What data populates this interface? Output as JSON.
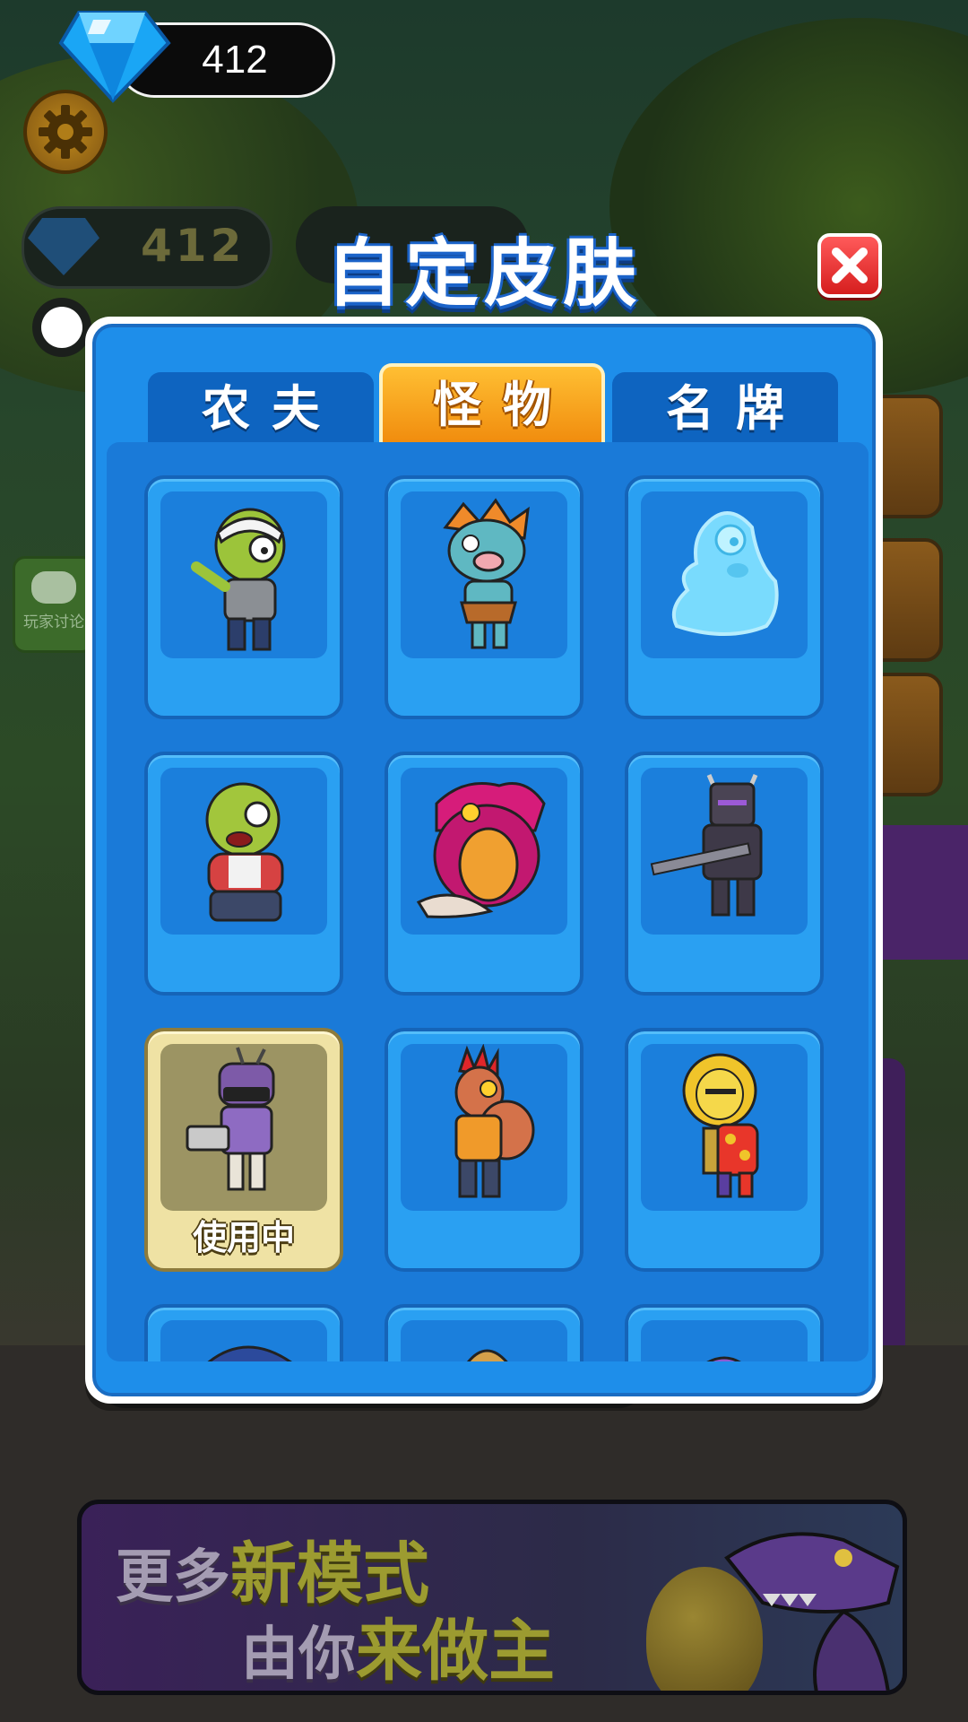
{
  "hud": {
    "gem_count": "412",
    "bg_gem_count": "412"
  },
  "chat_button": {
    "label": "玩家讨论"
  },
  "dialog": {
    "title": "自定皮肤",
    "tabs": [
      {
        "label": "农夫",
        "active": false
      },
      {
        "label": "怪物",
        "active": true
      },
      {
        "label": "名牌",
        "active": false
      }
    ],
    "skins": [
      {
        "name": "bandaged-zombie",
        "status": ""
      },
      {
        "name": "caveman-pig-zombie",
        "status": ""
      },
      {
        "name": "slime-ghost",
        "status": ""
      },
      {
        "name": "fat-green-zombie",
        "status": ""
      },
      {
        "name": "sea-monster",
        "status": ""
      },
      {
        "name": "dark-knight",
        "status": ""
      },
      {
        "name": "cameraman-zombie",
        "status": "使用中",
        "in_use": true
      },
      {
        "name": "punk-muscle-zombie",
        "status": ""
      },
      {
        "name": "lion-dancer-zombie",
        "status": ""
      }
    ]
  },
  "banner": {
    "line1_a": "更多",
    "line1_b": "新模式",
    "line2_a": "由你",
    "line2_b": "来做主"
  },
  "colors": {
    "panel_blue": "#1e8eea",
    "tab_active": "#f5a623",
    "tab_inactive": "#0e64c0",
    "close_red": "#e53935",
    "in_use_card": "#efe2a4"
  }
}
